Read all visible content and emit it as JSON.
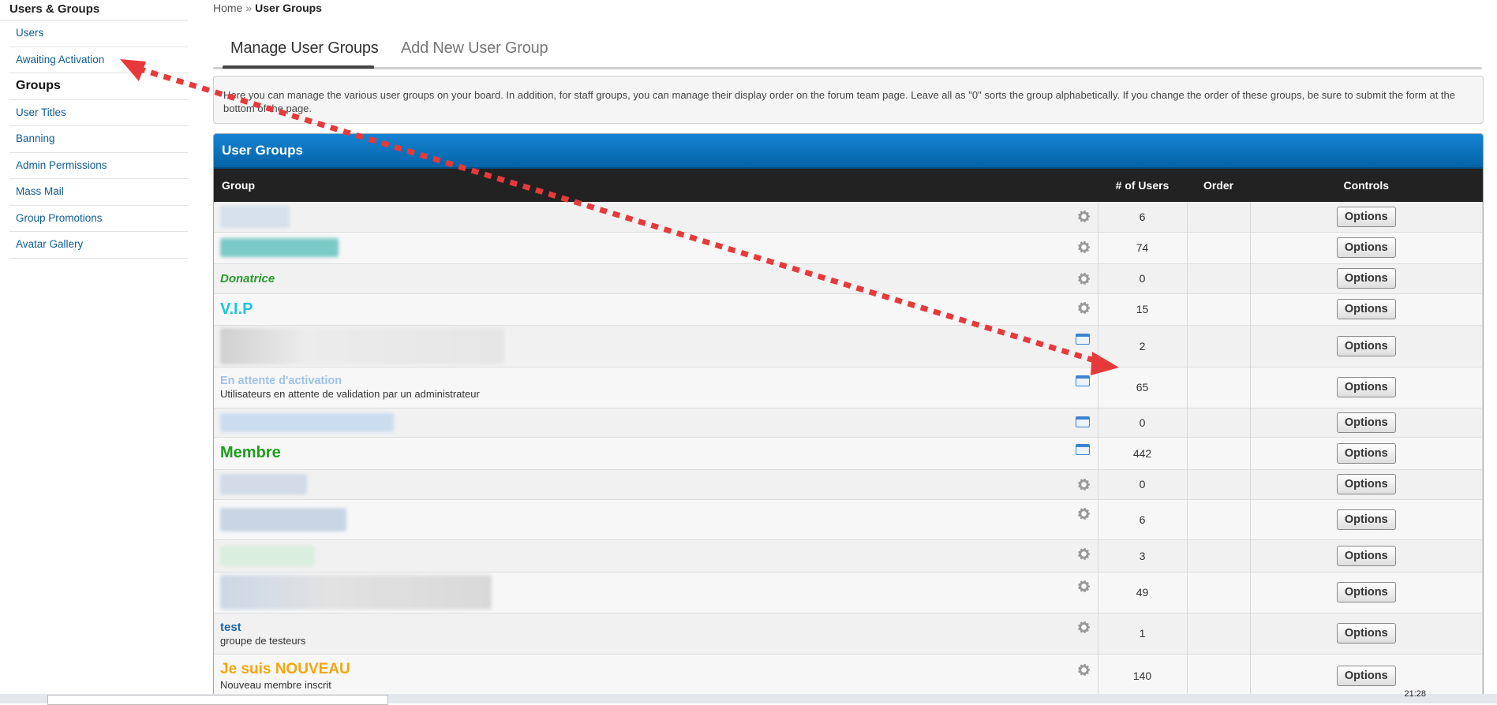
{
  "sidebar": {
    "title": "Users & Groups",
    "items": [
      {
        "label": "Users"
      },
      {
        "label": "Awaiting Activation"
      },
      {
        "label": "Groups"
      },
      {
        "label": "User Titles"
      },
      {
        "label": "Banning"
      },
      {
        "label": "Admin Permissions"
      },
      {
        "label": "Mass Mail"
      },
      {
        "label": "Group Promotions"
      },
      {
        "label": "Avatar Gallery"
      }
    ]
  },
  "breadcrumb": {
    "home": "Home",
    "sep": "»",
    "current": "User Groups"
  },
  "tabs": {
    "active": "Manage User Groups",
    "inactive": "Add New User Group"
  },
  "description": "Here you can manage the various user groups on your board. In addition, for staff groups, you can manage their display order on the forum team page. Leave all as \"0\" sorts the group alphabetically. If you change the order of these groups, be sure to submit the form at the bottom of the page.",
  "panel": {
    "title": "User Groups",
    "columns": {
      "group": "Group",
      "users": "# of Users",
      "order": "Order",
      "controls": "Controls"
    },
    "option_label": "Options",
    "rows": [
      {
        "name": "",
        "desc": "",
        "users": "6",
        "icon": "gear-icon",
        "color": "#1a67a8"
      },
      {
        "name": "",
        "desc": "",
        "users": "74",
        "icon": "gear-icon",
        "color": "#20a8a8"
      },
      {
        "name": "Donatrice",
        "desc": "",
        "users": "0",
        "icon": "gear-icon",
        "color": "#2b9a2b"
      },
      {
        "name": "V.I.P",
        "desc": "",
        "users": "15",
        "icon": "gear-icon",
        "color": "#19c7d6"
      },
      {
        "name": "",
        "desc": "",
        "users": "2",
        "icon": "window-icon",
        "color": "#777777"
      },
      {
        "name": "En attente d'activation",
        "desc": "Utilisateurs en attente de validation par un administrateur",
        "users": "65",
        "icon": "window-icon",
        "color": "#9ec3e8"
      },
      {
        "name": "",
        "desc": "",
        "users": "0",
        "icon": "window-icon",
        "color": "#8ab4df"
      },
      {
        "name": "Membre",
        "desc": "",
        "users": "442",
        "icon": "window-icon",
        "color": "#1f9b1f"
      },
      {
        "name": "",
        "desc": "",
        "users": "0",
        "icon": "gear-icon",
        "color": "#1a67a8"
      },
      {
        "name": "",
        "desc": "",
        "users": "6",
        "icon": "gear-icon",
        "color": "#1a67a8"
      },
      {
        "name": "",
        "desc": "",
        "users": "3",
        "icon": "gear-icon",
        "color": "#3fb36a"
      },
      {
        "name": "",
        "desc": "",
        "users": "49",
        "icon": "gear-icon",
        "color": "#1a67a8"
      },
      {
        "name": "test",
        "desc": "groupe de testeurs",
        "users": "1",
        "icon": "gear-icon",
        "color": "#1a67a8"
      },
      {
        "name": "Je suis NOUVEAU",
        "desc": "Nouveau membre inscrit",
        "users": "140",
        "icon": "gear-icon",
        "color": "#f3a60f"
      }
    ]
  },
  "taskbar": {
    "clock": "21:28"
  },
  "annotation": {
    "color": "#e8393a"
  }
}
